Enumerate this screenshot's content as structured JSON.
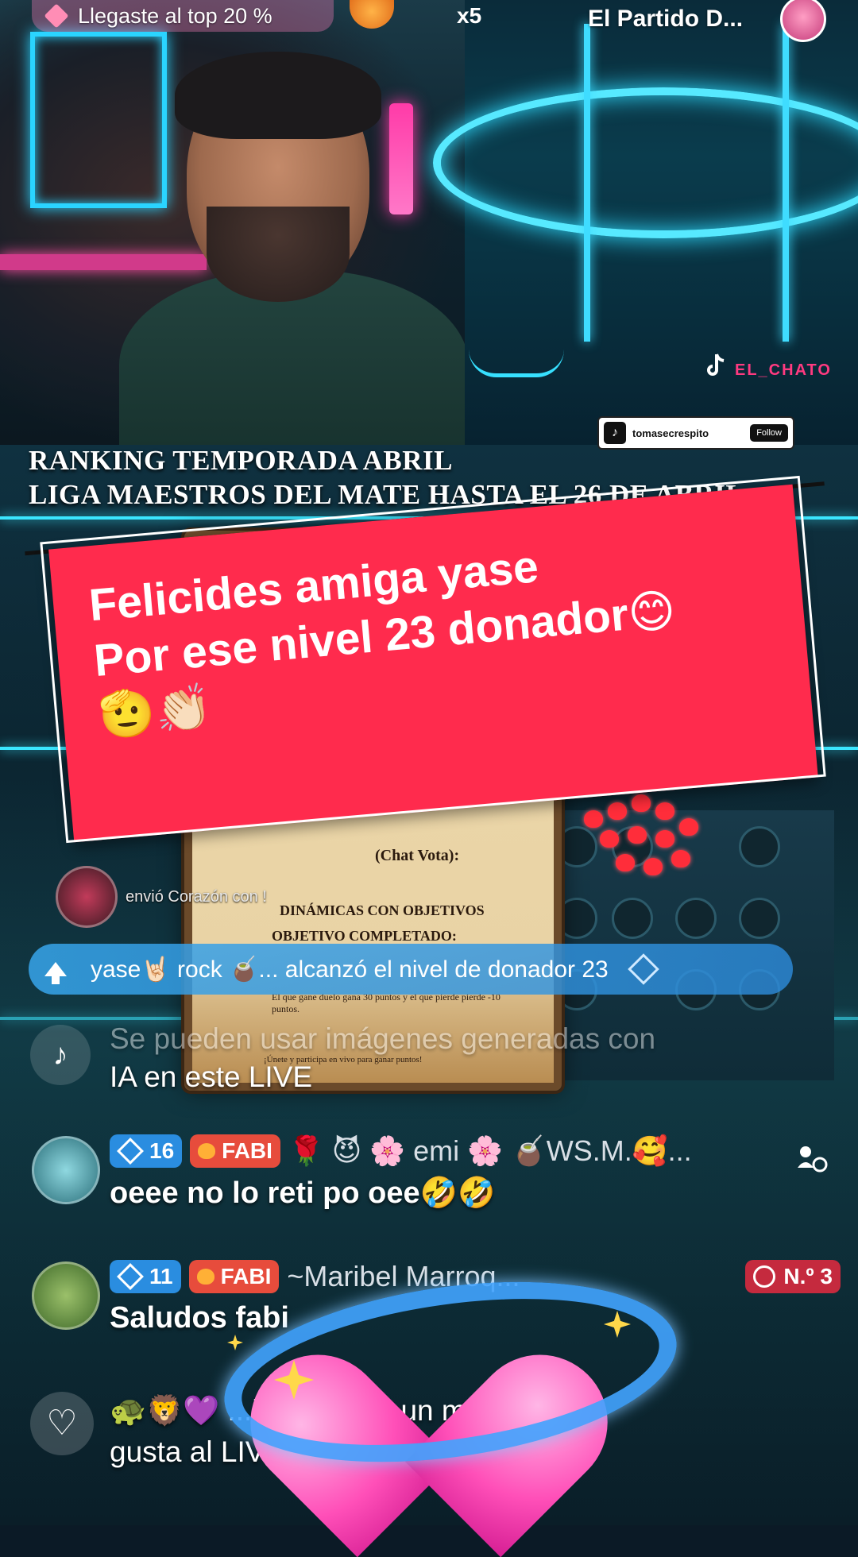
{
  "top_bar": {
    "rank_pill": "Llegaste al top 20 %",
    "multiplier": "x5",
    "host_name": "El Partido D..."
  },
  "overlay": {
    "ranking_line1": "RANKING TEMPORADA ABRIL",
    "ranking_line2": "LIGA MAESTROS DEL MATE HASTA EL 26 DE ABRIL",
    "watermark": "EL_CHATO",
    "tomase_handle": "tomasecrespito",
    "tomase_follow": "Follow"
  },
  "banner": {
    "text": "Felicides amiga yase\nPor ese nivel 23 donador😊\n🫡👏🏻"
  },
  "card": {
    "line1": "(Chat Vota):",
    "line2": "DINÁMICAS CON OBJETIVOS",
    "line3": "OBJETIVO COMPLETADO:",
    "line4": "El que gane duelo gana 30 puntos y el que pierde pierde -10 puntos.",
    "footer": "¡Únete y participa en vivo para ganar puntos!"
  },
  "chat": {
    "gift_line": "envió Corazón con !",
    "level_banner": "yase🤘🏻 rock 🧉... alcanzó el nivel de donador 23",
    "system_msg_line1": "Se pueden usar imágenes generadas con",
    "system_msg_line2": "IA en este LIVE",
    "messages": [
      {
        "level": "16",
        "team": "FABI",
        "names": "🌹 😈 🌸 emi 🌸 🧉WS.M.🥰...",
        "text": "oeee no lo reti po oee🤣🤣"
      },
      {
        "level": "11",
        "team": "FABI",
        "names": "~Maribel Marroq...",
        "rank": "N.º 3",
        "text": "Saludos fabi"
      }
    ],
    "bottom_msg_line1": "🐢🦁💜 ...ivo... le dio un me",
    "bottom_msg_line2": "gusta al LIVE"
  },
  "icons": {
    "like": "heart-outline-icon",
    "tiktok": "tiktok-icon",
    "share": "share-icon"
  },
  "colors": {
    "banner": "#ff2b4d",
    "level_banner": "#37a5eb",
    "fabi_badge": "#e74c3c",
    "level_badge": "#2a8de0"
  }
}
